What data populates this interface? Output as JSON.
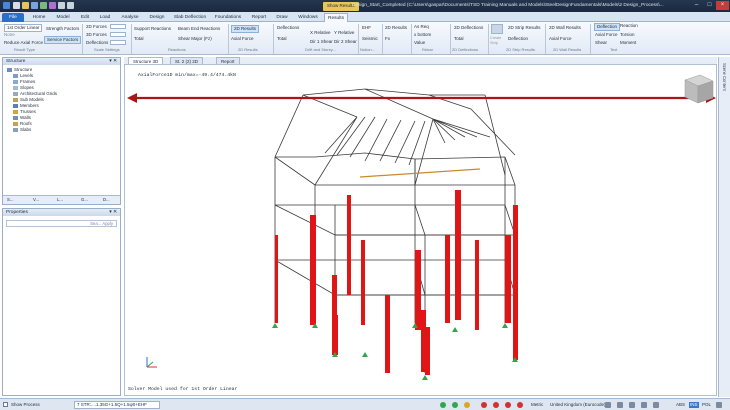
{
  "titlebar": {
    "context_tab": "Show Results",
    "title": "Design_Start_Completed (C:\\Users\\gaspar\\Documents\\TSD Training Manuals and Models\\SteelDesignFundamentals\\Models\\2 Design_Process\\..."
  },
  "menu": [
    "File",
    "Home",
    "Model",
    "Edit",
    "Load",
    "Analyse",
    "Design",
    "Slab Deflection",
    "Foundations",
    "Report",
    "Draw",
    "Windows",
    "Results"
  ],
  "ribbon": {
    "loadcase": "1st Order Linear",
    "none": "None",
    "reduce_axial": "Reduce Axial Force",
    "strength_factors": "Strength Factors",
    "service_factors": "Service Factors",
    "r_2d_forces": "2D Forces",
    "r_3d_forces": "3D Forces",
    "r_deflections": "Deflections",
    "support_reactions": "Support Reactions",
    "total": "Total",
    "beam_end_reactions": "Beam End Reactions",
    "shear_major": "Shear Major (Fz)",
    "r2d_results": "2D Results",
    "axial_force": "Axial Force",
    "deflections2": "Deflections",
    "total2": "Total",
    "x_relative": "X Relative",
    "y_relative": "Y Relative",
    "d1_shear": "Dir 1 Shear",
    "d2_shear": "Dir 2 Shear",
    "ehf": "EHF",
    "seismic": "Seismic",
    "r2d_results2": "2D Results",
    "fx": "Fx",
    "as_req": "As Req",
    "x_bottom": "x bottom",
    "value": "Value",
    "r2d_deflections": "2D Deflections",
    "total3": "Total",
    "create_strip": "Create Strip",
    "strip_2d_results": "2D Strip Results",
    "deflection": "Deflection",
    "wall_2d_results": "2D Wall Results",
    "axial_force2": "Axial Force",
    "deflection_hl": "Deflection",
    "axial_force3": "Axial Force",
    "shear": "Shear",
    "reaction": "Reaction",
    "torsion": "Torsion",
    "moment": "Moment",
    "groups": [
      "Result Type",
      "Scale Settings",
      "Reactions",
      "2D Results",
      "Drift and Storey...",
      "Notion...",
      "Rebar",
      "2D Deflections",
      "2D Strip Results",
      "2D Wall Results",
      "Text"
    ]
  },
  "structure_pane": {
    "title": "Structure",
    "items": [
      "Structure",
      "Levels",
      "Frames",
      "Slopes",
      "Architectural Grids",
      "Sub Models",
      "Members",
      "Trusses",
      "Walls",
      "Roofs",
      "Slabs"
    ],
    "tabs": [
      "S...",
      "V...",
      "L...",
      "G...",
      "D..."
    ]
  },
  "properties_pane": {
    "title": "Properties",
    "search_placeholder": "Sea... Apply"
  },
  "doc_tabs": [
    "Structure 3D",
    "St. 2 (2) 2D",
    "Report"
  ],
  "viewport": {
    "title": "AxialForce1D min/max=-49.4/474.4kN",
    "status_text": "Solver Model used for 1st Order Linear"
  },
  "right_strip_label": "Scene Content",
  "statusbar": {
    "show_process": "Show Process",
    "combo": "7 STR:....1.35G+1.5Q+1.5ψ0+EHF",
    "units": "Metric",
    "region": "United Kingdom (Eurocode)",
    "badges": [
      "ABS",
      "INS",
      "POL"
    ]
  },
  "colors": {
    "accent": "#2b6fcc",
    "force_fill": "#e01515",
    "support": "#2fa84a",
    "arrow": "#a81616"
  }
}
